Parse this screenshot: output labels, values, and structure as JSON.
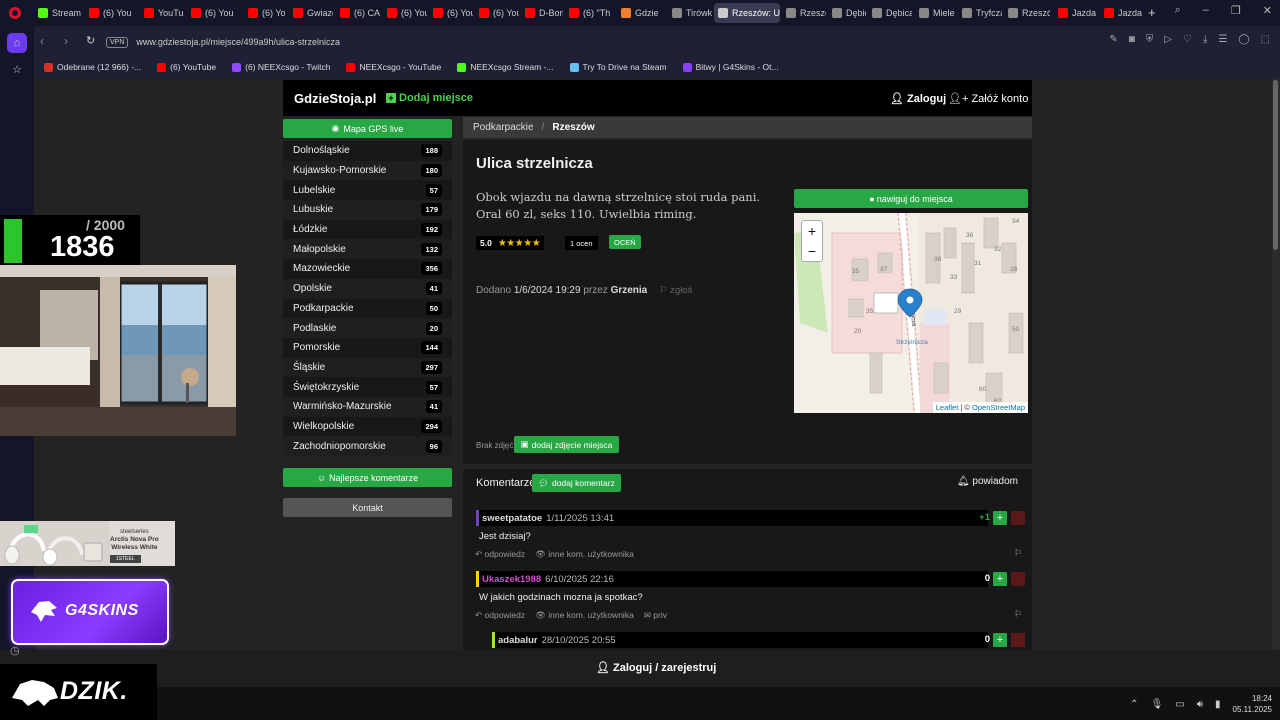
{
  "browser": {
    "tabs": [
      {
        "label": "Stream",
        "color": "#53fc18",
        "active": false
      },
      {
        "label": "(6) You",
        "color": "#ff0000",
        "active": false
      },
      {
        "label": "YouTub",
        "color": "#ff0000",
        "active": false
      },
      {
        "label": "(6) You",
        "color": "#ff0000",
        "active": false
      },
      {
        "label": "(6) You",
        "color": "#ff0000",
        "active": false
      },
      {
        "label": "Gwiazd",
        "color": "#ff0000",
        "active": false
      },
      {
        "label": "(6) CAI",
        "color": "#ff0000",
        "active": false
      },
      {
        "label": "(6) You",
        "color": "#ff0000",
        "active": false
      },
      {
        "label": "(6) You",
        "color": "#ff0000",
        "active": false
      },
      {
        "label": "(6) You",
        "color": "#ff0000",
        "active": false
      },
      {
        "label": "D-Bom",
        "color": "#ff0000",
        "active": false
      },
      {
        "label": "(6) \"Th",
        "color": "#ff0000",
        "active": false
      },
      {
        "label": "Gdzie",
        "color": "#f08030",
        "active": false
      },
      {
        "label": "Tirówk",
        "color": "#888888",
        "active": false
      },
      {
        "label": "Rzeszów: Uli",
        "color": "#cccccc",
        "active": true
      },
      {
        "label": "Rzeszó",
        "color": "#888888",
        "active": false
      },
      {
        "label": "Dębica",
        "color": "#888888",
        "active": false
      },
      {
        "label": "Dębica",
        "color": "#888888",
        "active": false
      },
      {
        "label": "Mielec",
        "color": "#888888",
        "active": false
      },
      {
        "label": "Tryfcza",
        "color": "#888888",
        "active": false
      },
      {
        "label": "Rzeszó",
        "color": "#888888",
        "active": false
      },
      {
        "label": "Jazda p",
        "color": "#ff0000",
        "active": false
      },
      {
        "label": "Jazda p",
        "color": "#ff0000",
        "active": false
      }
    ],
    "new_tab": "+",
    "url": "www.gdziestoja.pl/miejsce/499a9h/ulica-strzelnicza",
    "vpn": "VPN",
    "bookmarks": [
      {
        "label": "Odebrane (12 966) -...",
        "color": "#d93025"
      },
      {
        "label": "(6) YouTube",
        "color": "#ff0000"
      },
      {
        "label": "(6) NEEXcsgo - Twitch",
        "color": "#9146ff"
      },
      {
        "label": "NEEXcsgo - YouTube",
        "color": "#ff0000"
      },
      {
        "label": "NEEXcsgo Stream -...",
        "color": "#53fc18"
      },
      {
        "label": "Try To Drive na Steam",
        "color": "#66c0f4"
      },
      {
        "label": "Bitwy | G4Skins - Ot...",
        "color": "#8a3cff"
      }
    ]
  },
  "site": {
    "brand": "GdzieStoja.pl",
    "add_place": "Dodaj miejsce",
    "login": "Zaloguj",
    "register": "Załóż konto",
    "gps_button": "Mapa GPS live",
    "regions": [
      {
        "name": "Dolnośląskie",
        "count": "188"
      },
      {
        "name": "Kujawsko-Pomorskie",
        "count": "180"
      },
      {
        "name": "Lubelskie",
        "count": "57"
      },
      {
        "name": "Lubuskie",
        "count": "179"
      },
      {
        "name": "Łódzkie",
        "count": "192"
      },
      {
        "name": "Małopolskie",
        "count": "132"
      },
      {
        "name": "Mazowieckie",
        "count": "356"
      },
      {
        "name": "Opolskie",
        "count": "41"
      },
      {
        "name": "Podkarpackie",
        "count": "50"
      },
      {
        "name": "Podlaskie",
        "count": "20"
      },
      {
        "name": "Pomorskie",
        "count": "144"
      },
      {
        "name": "Śląskie",
        "count": "297"
      },
      {
        "name": "Świętokrzyskie",
        "count": "57"
      },
      {
        "name": "Warmińsko-Mazurskie",
        "count": "41"
      },
      {
        "name": "Wielkopolskie",
        "count": "294"
      },
      {
        "name": "Zachodniopomorskie",
        "count": "96"
      }
    ],
    "best_comments": "Najlepsze komentarze",
    "contact": "Kontakt",
    "breadcrumb": {
      "parent": "Podkarpackie",
      "separator": "/",
      "current": "Rzeszów"
    },
    "place": {
      "title": "Ulica strzelnicza",
      "description": "Obok wjazdu na dawną strzelnicę stoi ruda pani. Oral 60 zl, seks 110. Uwielbia riming.",
      "rating": "5.0",
      "stars": "★★★★★",
      "rating_count": "1 ocen",
      "rate_button": "OCEŃ",
      "added_label": "Dodano",
      "added_date": "1/6/2024 19:29",
      "by_label": "przez",
      "author": "Grzenia",
      "report": "zgłoś",
      "navigate_button": "nawiguj do miejsca",
      "map_street": "Strzelnicza",
      "map_road_label": "rzelnicza",
      "map_house_numbers": [
        "34",
        "36",
        "32",
        "38",
        "28",
        "35",
        "37",
        "31",
        "33",
        "35",
        "50",
        "29",
        "60",
        "62",
        "20"
      ],
      "map_zoom_in": "+",
      "map_zoom_out": "−",
      "map_attr_leaflet": "Leaflet",
      "map_attr_sep": "| ©",
      "map_attr_osm": "OpenStreetMap",
      "no_photos": "Brak zdjęć",
      "add_photo": "dodaj zdjęcie miejsca"
    },
    "comments": {
      "title": "Komentarze",
      "add_button": "dodaj komentarz",
      "notify": "powiadom",
      "items": [
        {
          "nick": "sweetpatatoe",
          "date": "1/11/2025 13:41",
          "score": "+1",
          "text": "Jest dzisiaj?",
          "reply": "odpowiedz",
          "more": "inne kom. użytkownika",
          "nick_color": "#dddddd",
          "bar_color": "#6f42c1",
          "score_color": "#28a745"
        },
        {
          "nick": "Ukaszek1988",
          "date": "6/10/2025 22:16",
          "score": "0",
          "text": "W jakich godzinach mozna ja spotkac?",
          "reply": "odpowiedz",
          "more": "inne kom. użytkownika",
          "priv": "priv",
          "nick_color": "#d24ed2",
          "bar_color": "#ffd400",
          "score_color": "#ffffff"
        },
        {
          "nick": "adabalur",
          "date": "28/10/2025 20:55",
          "score": "0",
          "nick_color": "#dddddd",
          "bar_color": "#a3e635",
          "score_color": "#ffffff"
        }
      ]
    },
    "bottom_login": "Zaloguj / zarejestruj"
  },
  "overlays": {
    "counter_max": "/ 2000",
    "counter_value": "1836",
    "ad_lines": [
      "steelseries",
      "Arctis Nova Pro",
      "Wireless White"
    ],
    "ad_tag": "1STEEL",
    "g4_label": "G4SKINS",
    "dzik_label": "DZIK."
  },
  "taskbar": {
    "time": "18:24",
    "date": "05.11.2025"
  }
}
